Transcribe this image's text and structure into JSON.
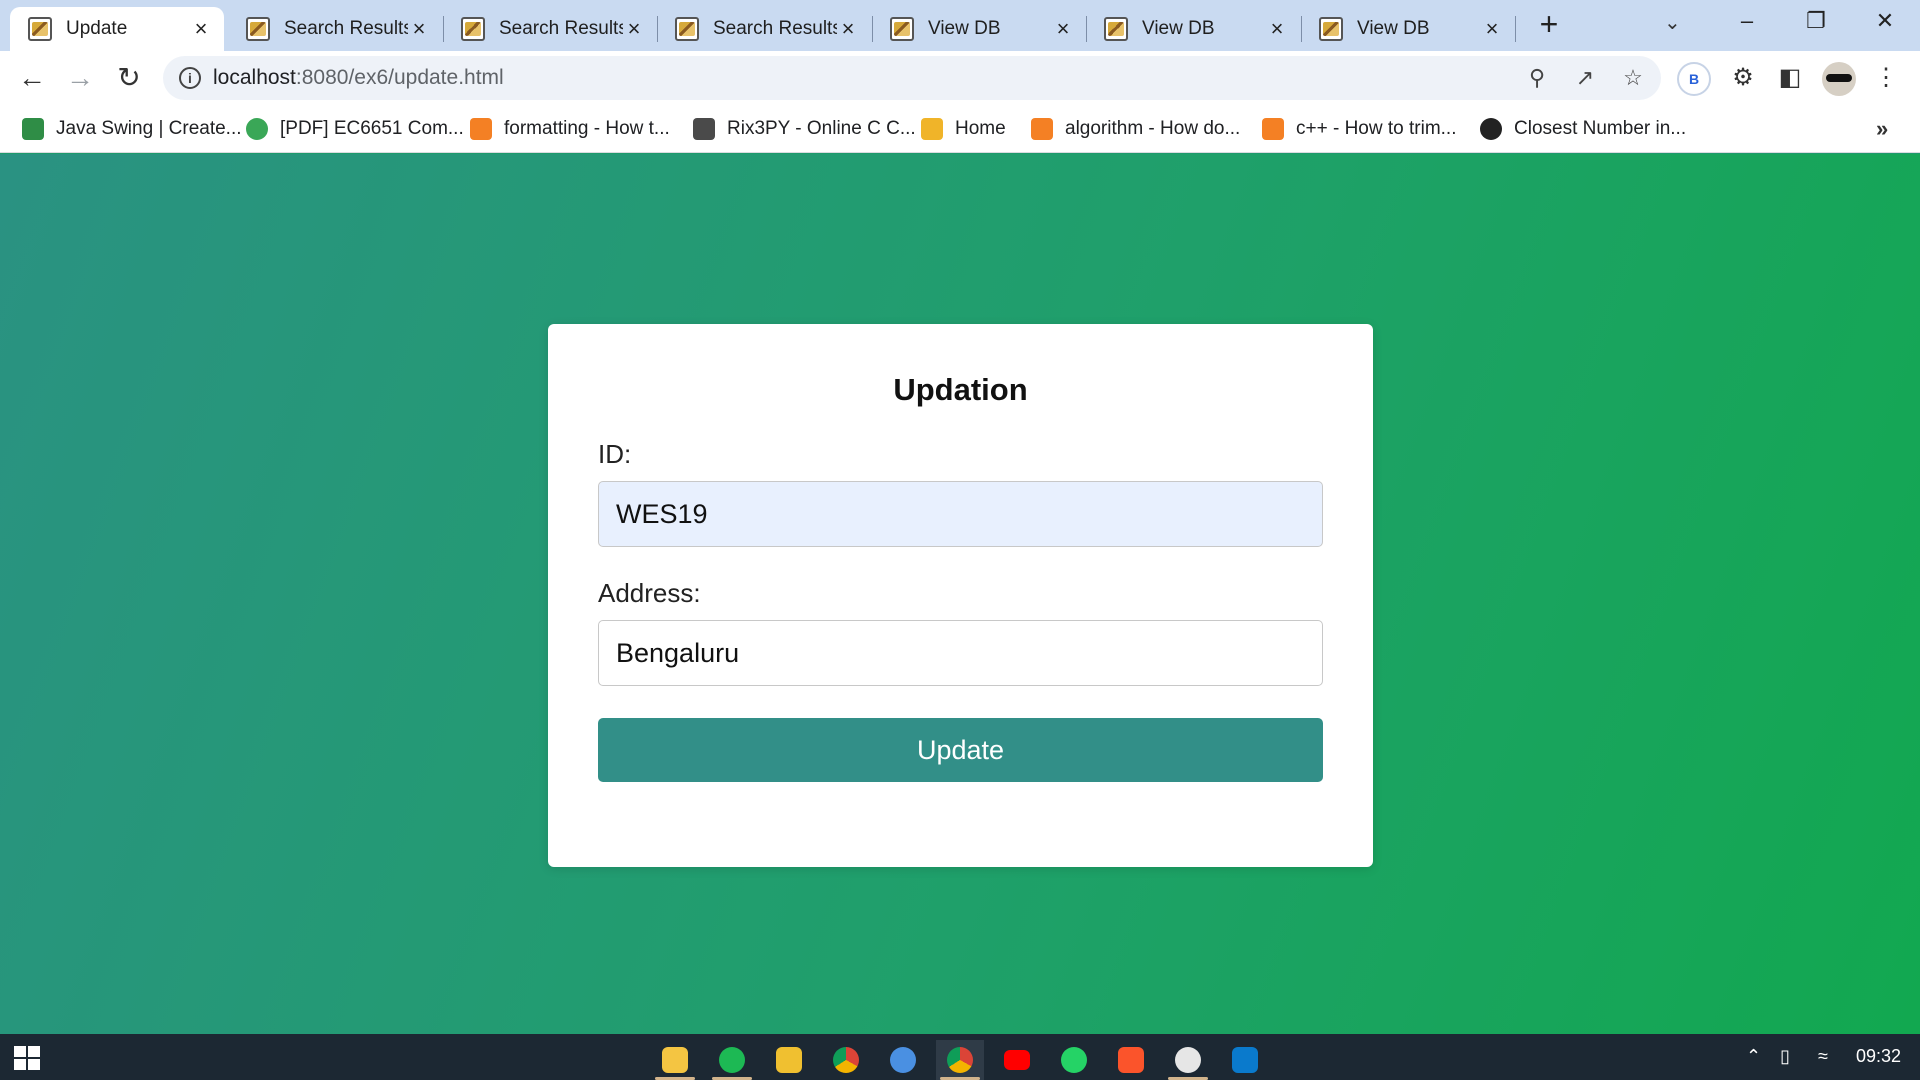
{
  "browser": {
    "tabs": [
      {
        "title": "Update",
        "active": true
      },
      {
        "title": "Search Results",
        "active": false
      },
      {
        "title": "Search Results",
        "active": false
      },
      {
        "title": "Search Results",
        "active": false
      },
      {
        "title": "View DB",
        "active": false
      },
      {
        "title": "View DB",
        "active": false
      },
      {
        "title": "View DB",
        "active": false
      }
    ],
    "new_tab_icon": "plus-icon",
    "address_host": "localhost",
    "address_path": ":8080/ex6/update.html",
    "profile_initial": "B",
    "bookmarks": [
      {
        "label": "Java Swing | Create...",
        "icon": "geeksforgeeks-icon",
        "color": "#2f8d46"
      },
      {
        "label": "[PDF] EC6651 Com...",
        "icon": "globe-icon",
        "color": "#3aa757"
      },
      {
        "label": "formatting - How t...",
        "icon": "stackoverflow-icon",
        "color": "#f48024"
      },
      {
        "label": "Rix3PY - Online C C...",
        "icon": "ideone-icon",
        "color": "#4a4a4a"
      },
      {
        "label": "Home",
        "icon": "box-icon",
        "color": "#f0b429"
      },
      {
        "label": "algorithm - How do...",
        "icon": "stackoverflow-icon",
        "color": "#f48024"
      },
      {
        "label": "c++ - How to trim...",
        "icon": "stackoverflow-icon",
        "color": "#f48024"
      },
      {
        "label": "Closest Number in...",
        "icon": "globe-dark-icon",
        "color": "#222222"
      }
    ]
  },
  "form": {
    "heading": "Updation",
    "id_label": "ID:",
    "id_value": "WES19",
    "address_label": "Address:",
    "address_value": "Bengaluru",
    "submit_label": "Update"
  },
  "taskbar": {
    "apps": [
      {
        "name": "file-explorer-icon",
        "color": "#f4c542"
      },
      {
        "name": "spotify-icon",
        "color": "#1db954"
      },
      {
        "name": "network-app-icon",
        "color": "#f0c030"
      },
      {
        "name": "chrome-icon",
        "color": "#db4437"
      },
      {
        "name": "spotify-alt-icon",
        "color": "#4a90e2"
      },
      {
        "name": "chrome-active-icon",
        "color": "#db4437"
      },
      {
        "name": "youtube-icon",
        "color": "#ff0000"
      },
      {
        "name": "whatsapp-icon",
        "color": "#25d366"
      },
      {
        "name": "brave-icon",
        "color": "#fb542b"
      },
      {
        "name": "settings-icon",
        "color": "#e6e6e6"
      },
      {
        "name": "vscode-icon",
        "color": "#0a7acc"
      }
    ],
    "clock": "09:32"
  }
}
